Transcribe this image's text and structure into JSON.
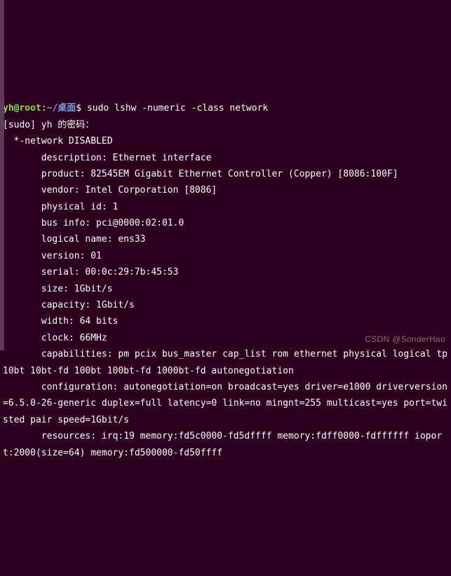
{
  "prompt": {
    "user": "yh",
    "at": "@",
    "host": "root",
    "colon": ":",
    "path": "~/桌面",
    "symbol": "$ "
  },
  "command": "sudo lshw -numeric -class network",
  "sudo_prompt": "[sudo] yh 的密码：",
  "header": "*-network DISABLED",
  "fields": {
    "description": "description: Ethernet interface",
    "product": "product: 82545EM Gigabit Ethernet Controller (Copper) [8086:100F]",
    "vendor": "vendor: Intel Corporation [8086]",
    "physical_id": "physical id: 1",
    "bus_info": "bus info: pci@0000:02:01.0",
    "logical_name": "logical name: ens33",
    "version": "version: 01",
    "serial": "serial: 00:0c:29:7b:45:53",
    "size": "size: 1Gbit/s",
    "capacity": "capacity: 1Gbit/s",
    "width": "width: 64 bits",
    "clock": "clock: 66MHz",
    "capabilities": "capabilities: pm pcix bus_master cap_list rom ethernet physical logical tp 10bt 10bt-fd 100bt 100bt-fd 1000bt-fd autonegotiation",
    "configuration": "configuration: autonegotiation=on broadcast=yes driver=e1000 driverversion=6.5.0-26-generic duplex=full latency=0 link=no mingnt=255 multicast=yes port=twisted pair speed=1Gbit/s",
    "resources": "resources: irq:19 memory:fd5c0000-fd5dffff memory:fdff0000-fdffffff ioport:2000(size=64) memory:fd500000-fd50ffff"
  },
  "watermark": "CSDN @SonderHao"
}
